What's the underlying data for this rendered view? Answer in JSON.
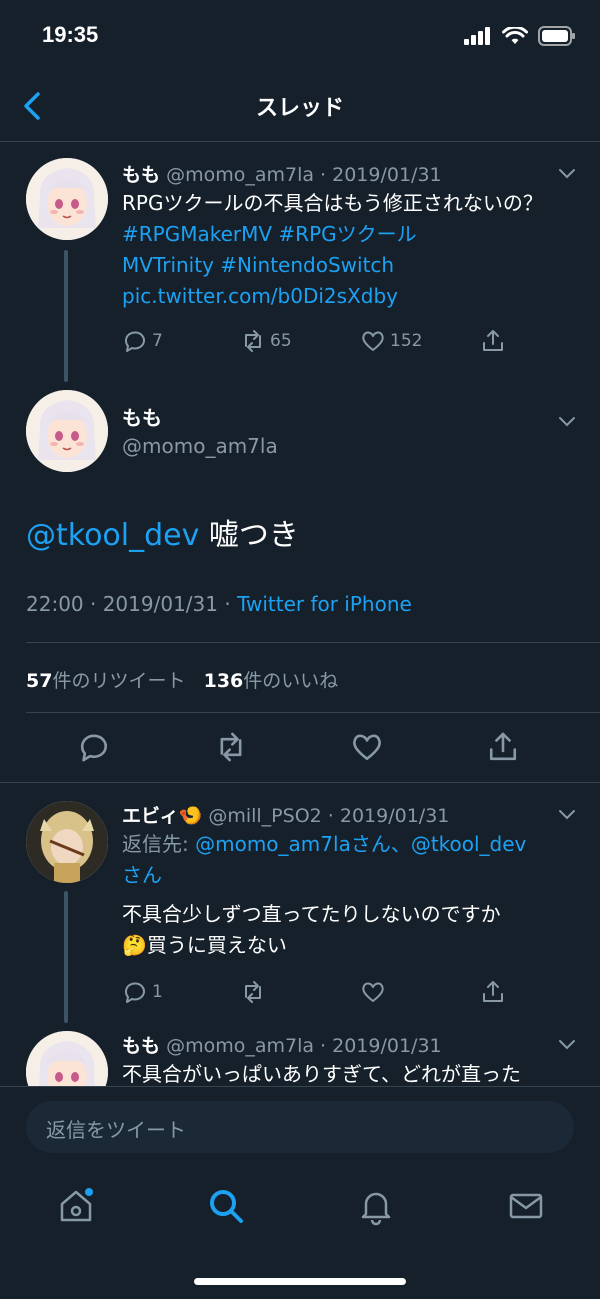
{
  "status": {
    "time": "19:35"
  },
  "header": {
    "title": "スレッド"
  },
  "thread": [
    {
      "name": "もも",
      "handle": "@momo_am7la",
      "date": "2019/01/31",
      "text_plain": "RPGツクールの不具合はもう修正されないの？ ",
      "hashtag1": "#RPGMakerMV",
      "hashtag2": "#RPGツクール",
      "hashtag3": "MVTrinity",
      "hashtag4": "#NintendoSwitch",
      "link": "pic.twitter.com/b0Di2sXdby",
      "replies": "7",
      "retweets": "65",
      "likes": "152"
    }
  ],
  "focus": {
    "name": "もも",
    "handle": "@momo_am7la",
    "mention": "@tkool_dev",
    "text": " 嘘つき",
    "time": "22:00 · 2019/01/31 · ",
    "source": "Twitter for iPhone",
    "retweets_count": "57",
    "retweets_label": "件のリツイート",
    "likes_count": "136",
    "likes_label": "件のいいね"
  },
  "replies": [
    {
      "name": "エビィ🍤",
      "handle": "@mill_PSO2",
      "date": "2019/01/31",
      "reply_to_prefix": "返信先: ",
      "reply_to_1": "@momo_am7laさん、@tkool_dev",
      "reply_to_2": "さん",
      "text_line1": "不具合少しずつ直ってたりしないのですか",
      "text_line2": "🤔買うに買えない",
      "replies": "1"
    },
    {
      "name": "もも",
      "handle": "@momo_am7la",
      "date": "2019/01/31",
      "text_line1": "不具合がいっぱいありすぎて、どれが直った"
    }
  ],
  "composer": {
    "placeholder": "返信をツイート"
  },
  "colors": {
    "background": "#15202b",
    "accent": "#1da1f2",
    "muted": "#8899a6",
    "divider": "#38444d"
  },
  "icons": [
    "back-icon",
    "chevron-down-icon",
    "reply-icon",
    "retweet-icon",
    "like-icon",
    "share-icon",
    "home-icon",
    "search-icon",
    "notifications-icon",
    "messages-icon"
  ]
}
